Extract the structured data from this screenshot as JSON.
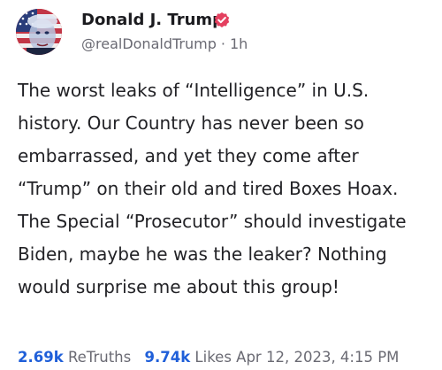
{
  "author": {
    "display_name": "Donald J. Trump",
    "handle": "@realDonaldTrump",
    "separator": "·",
    "time_ago": "1h",
    "avatar_icon": "avatar-image",
    "verified_icon": "verified-badge-icon",
    "verified_color": "#e4405f"
  },
  "post": {
    "body": "The worst leaks of “Intelligence” in U.S. history. Our Country has never been so embarrassed, and yet they come after “Trump” on their old and tired Boxes Hoax. The Special “Prosecutor” should investigate Biden, maybe he was the leaker? Nothing would surprise me about this group!"
  },
  "stats": {
    "retruths_count": "2.69k",
    "retruths_label": "ReTruths",
    "likes_count": "9.74k",
    "likes_label": "Likes",
    "timestamp": "Apr 12, 2023, 4:15 PM",
    "accent_color": "#1f5fd9"
  }
}
